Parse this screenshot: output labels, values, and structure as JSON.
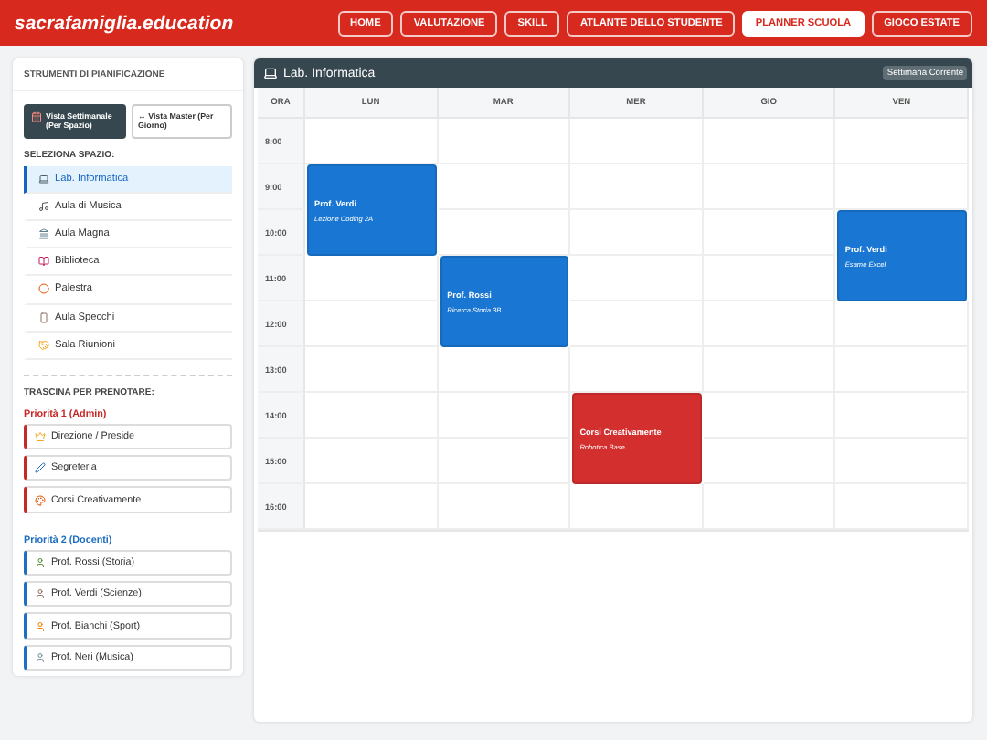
{
  "header": {
    "brand": "sacrafamiglia.education",
    "nav": [
      {
        "label": "HOME",
        "selected": false
      },
      {
        "label": "VALUTAZIONE",
        "selected": false
      },
      {
        "label": "SKILL",
        "selected": false
      },
      {
        "label": "ATLANTE DELLO STUDENTE",
        "selected": false
      },
      {
        "label": "PLANNER SCUOLA",
        "selected": true
      },
      {
        "label": "GIOCO ESTATE",
        "selected": false
      }
    ]
  },
  "sidebar": {
    "title": "STRUMENTI DI PIANIFICAZIONE",
    "views": [
      {
        "label": "Vista Settimanale (Per Spazio)",
        "selected": true
      },
      {
        "label": "↔ Vista Master (Per Giorno)",
        "selected": false
      }
    ],
    "spaces_label": "SELEZIONA SPAZIO:",
    "spaces": [
      {
        "label": "Lab. Informatica",
        "selected": true
      },
      {
        "label": "Aula di Musica",
        "selected": false
      },
      {
        "label": "Aula Magna",
        "selected": false
      },
      {
        "label": "Biblioteca",
        "selected": false
      },
      {
        "label": "Palestra",
        "selected": false
      },
      {
        "label": "Aula Specchi",
        "selected": false
      },
      {
        "label": "Sala Riunioni",
        "selected": false
      }
    ],
    "drag_label": "TRASCINA PER PRENOTARE:",
    "groups": [
      {
        "title": "Priorità 1 (Admin)",
        "color": "#c62828",
        "items": [
          "Direzione / Preside",
          "Segreteria",
          "Corsi Creativamente"
        ]
      },
      {
        "title": "Priorità 2 (Docenti)",
        "color": "#1e6fc0",
        "items": [
          "Prof. Rossi (Storia)",
          "Prof. Verdi (Scienze)",
          "Prof. Bianchi (Sport)",
          "Prof. Neri (Musica)"
        ]
      }
    ]
  },
  "calendar": {
    "title": "Lab. Informatica",
    "badge": "Settimana Corrente",
    "time_heading": "ORA",
    "times": [
      "8:00",
      "9:00",
      "10:00",
      "11:00",
      "12:00",
      "13:00",
      "14:00",
      "15:00",
      "16:00"
    ],
    "days": [
      {
        "label": "LUN",
        "slots": [
          {
            "kind": "empty"
          },
          {
            "kind": "event",
            "title": "Prof. Verdi",
            "subtitle": "Lezione Coding 2A",
            "color": "#1976d2"
          },
          {
            "kind": "continued"
          },
          {
            "kind": "empty"
          },
          {
            "kind": "empty"
          },
          {
            "kind": "empty"
          },
          {
            "kind": "empty"
          },
          {
            "kind": "empty"
          },
          {
            "kind": "empty"
          }
        ]
      },
      {
        "label": "MAR",
        "slots": [
          {
            "kind": "empty"
          },
          {
            "kind": "empty"
          },
          {
            "kind": "empty"
          },
          {
            "kind": "event",
            "title": "Prof. Rossi",
            "subtitle": "Ricerca Storia 3B",
            "color": "#1976d2"
          },
          {
            "kind": "continued"
          },
          {
            "kind": "empty"
          },
          {
            "kind": "empty"
          },
          {
            "kind": "empty"
          },
          {
            "kind": "empty"
          }
        ]
      },
      {
        "label": "MER",
        "slots": [
          {
            "kind": "empty"
          },
          {
            "kind": "empty"
          },
          {
            "kind": "empty"
          },
          {
            "kind": "empty"
          },
          {
            "kind": "empty"
          },
          {
            "kind": "empty"
          },
          {
            "kind": "event",
            "title": "Corsi Creativamente",
            "subtitle": "Robotica Base",
            "color": "#d32f2f"
          },
          {
            "kind": "continued"
          },
          {
            "kind": "empty"
          }
        ]
      },
      {
        "label": "GIO",
        "slots": [
          {
            "kind": "empty"
          },
          {
            "kind": "empty"
          },
          {
            "kind": "empty"
          },
          {
            "kind": "empty"
          },
          {
            "kind": "empty"
          },
          {
            "kind": "empty"
          },
          {
            "kind": "empty"
          },
          {
            "kind": "empty"
          },
          {
            "kind": "empty"
          }
        ]
      },
      {
        "label": "VEN",
        "slots": [
          {
            "kind": "empty"
          },
          {
            "kind": "empty"
          },
          {
            "kind": "event",
            "title": "Prof. Verdi",
            "subtitle": "Esame Excel",
            "color": "#1976d2"
          },
          {
            "kind": "continued"
          },
          {
            "kind": "empty"
          },
          {
            "kind": "empty"
          },
          {
            "kind": "empty"
          },
          {
            "kind": "empty"
          },
          {
            "kind": "empty"
          }
        ]
      }
    ]
  }
}
